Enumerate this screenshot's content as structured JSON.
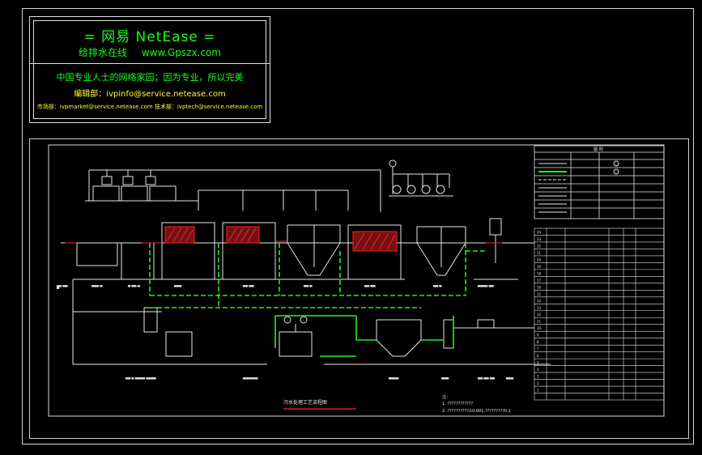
{
  "banner": {
    "title": "= 网易 NetEase =",
    "subtitle": "给排水在线 www.Gpszx.com",
    "line1": "中国专业人士的网络家园；因为专业，所以完美",
    "line2": "编辑部：ivpinfo@service.netease.com",
    "line3": "市场部：ivpmarket@service.netease.com 技术部：ivptech@service.netease.com"
  },
  "drawing": {
    "title": "污水处理工艺流程图",
    "notes": [
      "1. ????????????",
      "2. ??????????±0.001,?????????0.2"
    ],
    "legend_title": "图 例",
    "table_rows": 24,
    "colors": {
      "green": "#22ee22",
      "red": "#ff2020",
      "white": "#e6e6e6"
    }
  }
}
